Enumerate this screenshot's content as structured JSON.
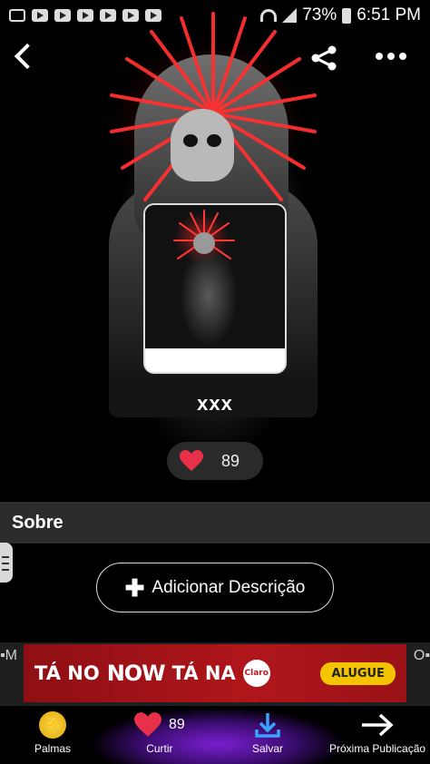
{
  "status_bar": {
    "battery": "73%",
    "time": "6:51 PM"
  },
  "post": {
    "title": "xxx",
    "likes": "89"
  },
  "section": {
    "title": "Sobre"
  },
  "actions": {
    "add_description": "Adicionar Descrição"
  },
  "ad": {
    "left_letter": "M",
    "right_letter": "O",
    "text_1": "TÁ NO",
    "brand": "NOW",
    "text_2": "TÁ NA",
    "logo": "Claro",
    "button": "ALUGUE"
  },
  "bottom_nav": {
    "items": [
      {
        "label": "Palmas",
        "icon": "coin-icon"
      },
      {
        "label": "Curtir",
        "icon": "heart-icon",
        "count": "89"
      },
      {
        "label": "Salvar",
        "icon": "download-icon"
      },
      {
        "label": "Próxima Publicação",
        "icon": "arrow-right-icon"
      }
    ]
  },
  "colors": {
    "accent_red": "#ff2a2a",
    "heart": "#e8304a",
    "coin": "#f2c230"
  }
}
